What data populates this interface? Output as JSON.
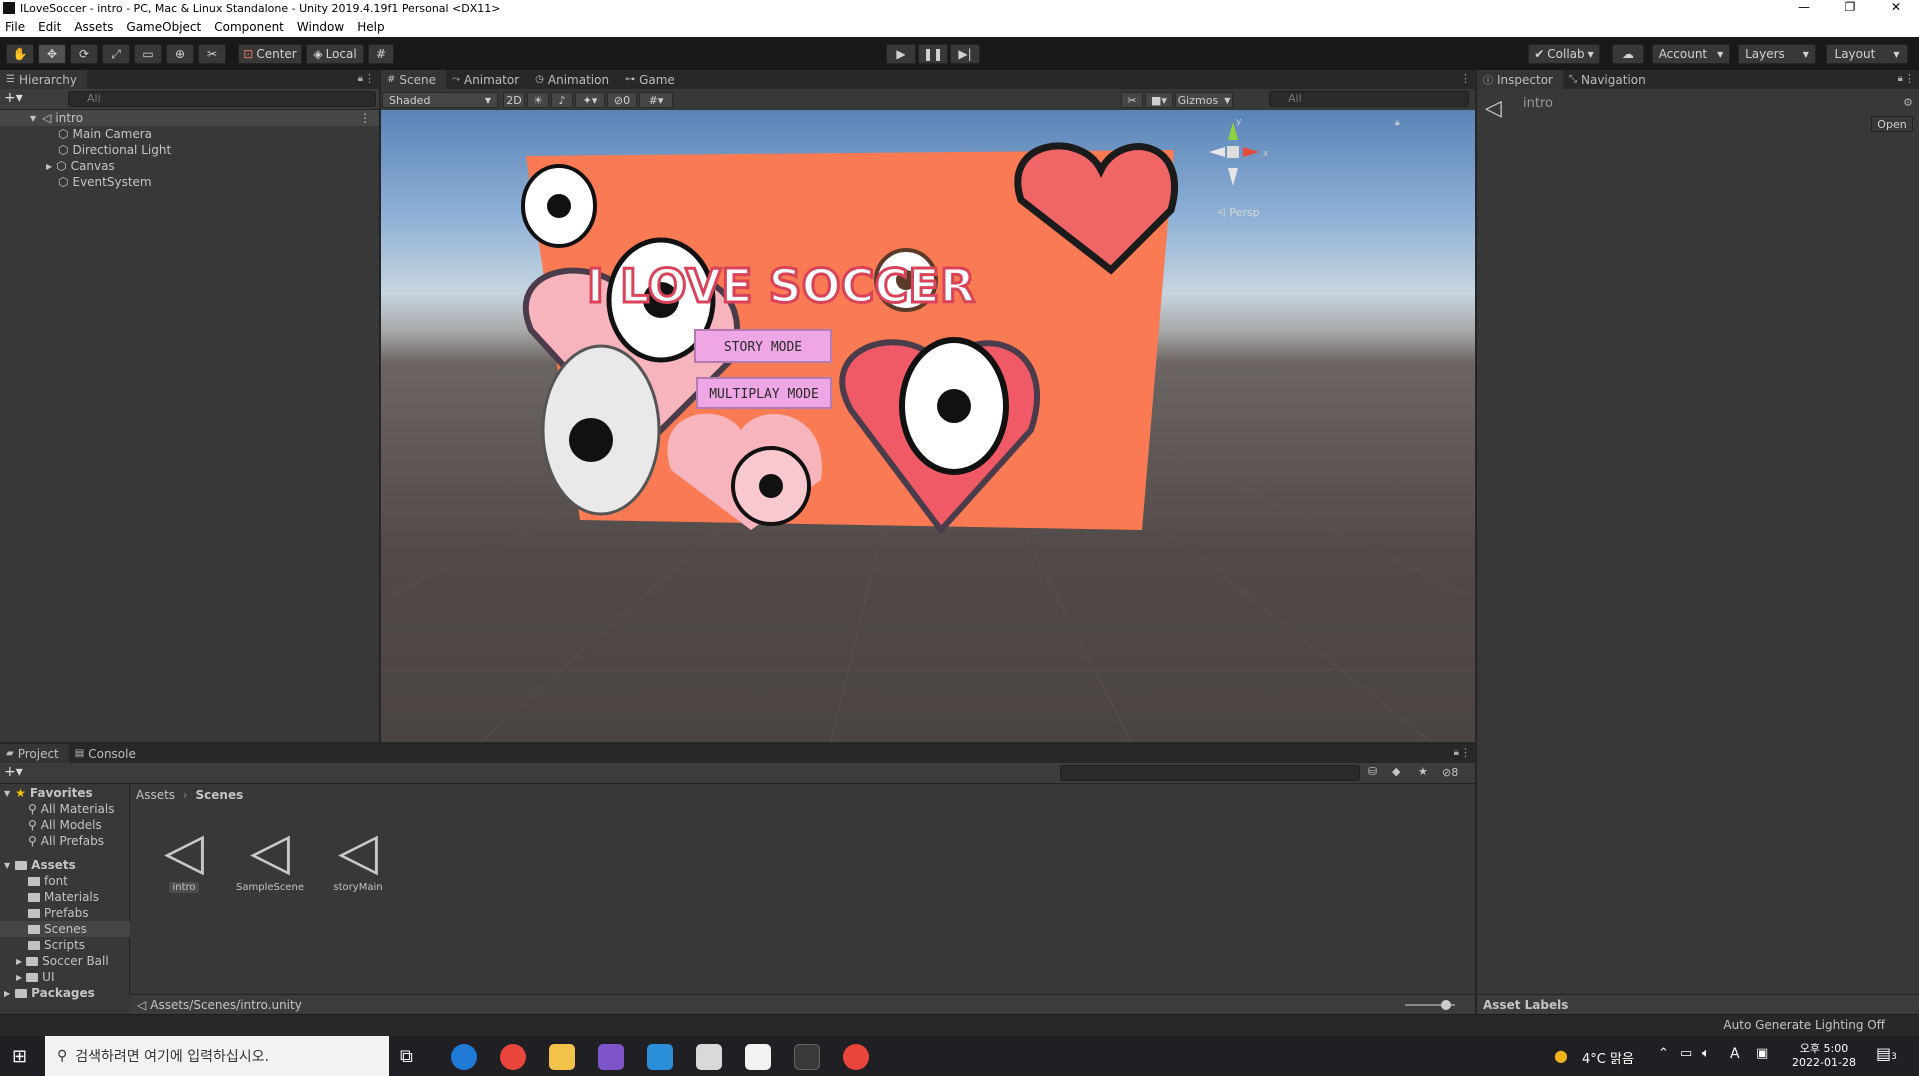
{
  "window": {
    "title": "ILoveSoccer - intro - PC, Mac & Linux Standalone - Unity 2019.4.19f1 Personal <DX11>",
    "minimize": "—",
    "restore": "❐",
    "close": "✕"
  },
  "menu": [
    "File",
    "Edit",
    "Assets",
    "GameObject",
    "Component",
    "Window",
    "Help"
  ],
  "toolbar": {
    "pivot": "Center",
    "space": "Local",
    "collab": "Collab",
    "account": "Account",
    "layers": "Layers",
    "layout": "Layout"
  },
  "hierarchy": {
    "tab": "Hierarchy",
    "search_placeholder": "All",
    "scene_root": "intro",
    "items": [
      "Main Camera",
      "Directional Light",
      "Canvas",
      "EventSystem"
    ]
  },
  "scene_panel": {
    "tabs": [
      "Scene",
      "Animator",
      "Animation",
      "Game"
    ],
    "shading": "Shaded",
    "mode_2d": "2D",
    "hidden_count": "0",
    "gizmos": "Gizmos",
    "search_placeholder": "All",
    "persp_label": "Persp",
    "gizmo_y": "y",
    "gizmo_x": "x",
    "game_title": "I LOVE SOCCER",
    "story_button": "STORY MODE",
    "multiplay_button": "MULTIPLAY MODE"
  },
  "inspector": {
    "tabs": [
      "Inspector",
      "Navigation"
    ],
    "object_name": "intro",
    "open_button": "Open",
    "asset_labels": "Asset Labels"
  },
  "project": {
    "tabs": [
      "Project",
      "Console"
    ],
    "hidden_count": "8",
    "favorites": {
      "label": "Favorites",
      "items": [
        "All Materials",
        "All Models",
        "All Prefabs"
      ]
    },
    "assets": {
      "label": "Assets",
      "items": [
        "font",
        "Materials",
        "Prefabs",
        "Scenes",
        "Scripts",
        "Soccer Ball",
        "UI"
      ]
    },
    "packages_label": "Packages",
    "breadcrumb": [
      "Assets",
      "Scenes"
    ],
    "files": [
      "intro",
      "SampleScene",
      "storyMain"
    ],
    "path": "Assets/Scenes/intro.unity"
  },
  "status": {
    "right_text": "Auto Generate Lighting Off"
  },
  "taskbar": {
    "search_placeholder": "검색하려면 여기에 입력하십시오.",
    "weather": "4°C 맑음",
    "ime": "A",
    "time": "오후 5:00",
    "date": "2022-01-28",
    "notifications": "3"
  }
}
